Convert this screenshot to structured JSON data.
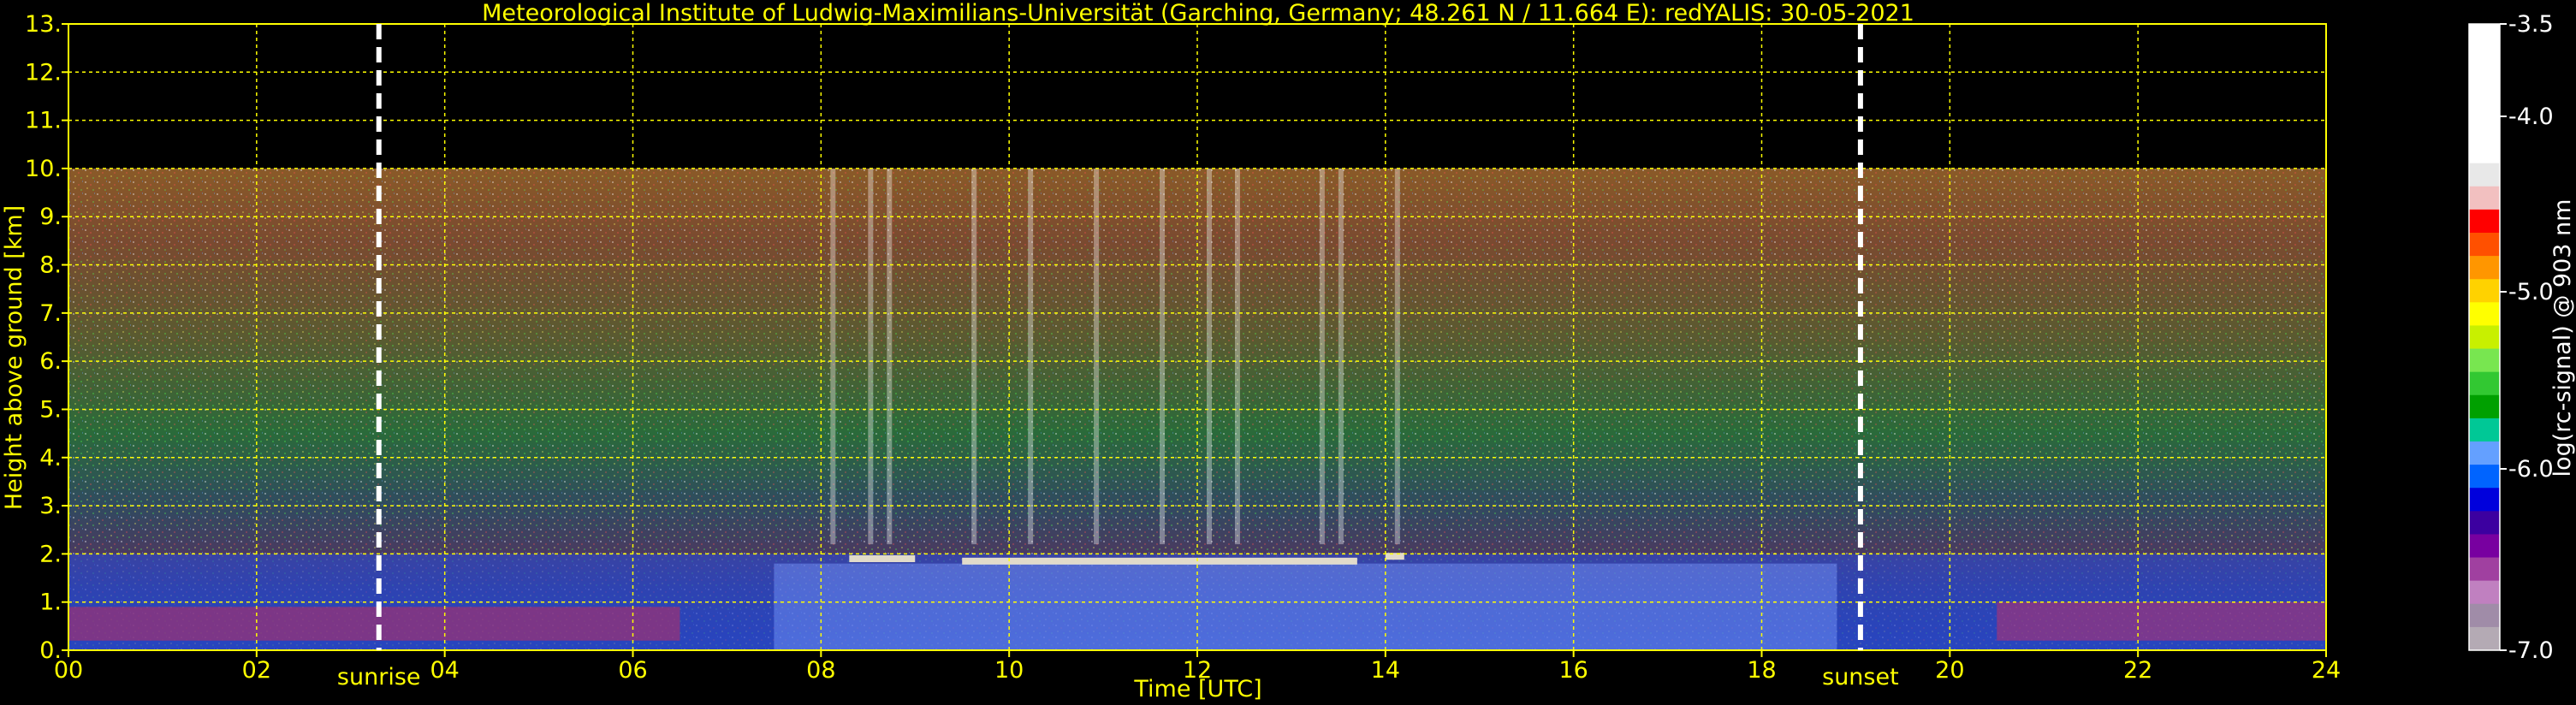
{
  "chart_data": {
    "type": "heatmap",
    "title": "Meteorological Institute of Ludwig-Maximilians-Universität (Garching, Germany; 48.261 N / 11.664 E):    redYALIS: 30-05-2021",
    "xlabel": "Time [UTC]",
    "ylabel": "Height above ground [km]",
    "xlim": [
      0,
      24
    ],
    "ylim": [
      0,
      13
    ],
    "x_ticks": [
      "00",
      "02",
      "04",
      "06",
      "08",
      "10",
      "12",
      "14",
      "16",
      "18",
      "20",
      "22",
      "24"
    ],
    "y_ticks": [
      "0.",
      "1.",
      "2.",
      "3.",
      "4.",
      "5.",
      "6.",
      "7.",
      "8.",
      "9.",
      "10.",
      "11.",
      "12.",
      "13."
    ],
    "grid": true,
    "data_top_height_km": 10,
    "events": [
      {
        "label": "sunrise",
        "time_h": 3.3
      },
      {
        "label": "sunset",
        "time_h": 19.05
      }
    ],
    "cloud_layers": [
      {
        "start_h": 8.3,
        "end_h": 9.0,
        "height_km": 1.9
      },
      {
        "start_h": 9.5,
        "end_h": 13.7,
        "height_km": 1.85
      },
      {
        "start_h": 14.0,
        "end_h": 14.2,
        "height_km": 1.95
      }
    ],
    "colorbar": {
      "label": "log(rc-signal) @ 903 nm",
      "min": -7.0,
      "max": -3.5,
      "tick_labels": [
        "-3.5",
        "-4.0",
        "-5.0",
        "-6.0",
        "-7.0"
      ],
      "tick_values": [
        -3.5,
        -4.0,
        -5.0,
        -6.0,
        -7.0
      ],
      "colors": [
        "#ffffff",
        "#e8e8e8",
        "#f2c0c0",
        "#ff0000",
        "#ff5000",
        "#ff9600",
        "#ffd200",
        "#ffff00",
        "#c8f000",
        "#78e650",
        "#32c832",
        "#00a000",
        "#00c896",
        "#64a0ff",
        "#0064ff",
        "#0000dc",
        "#3c00a0",
        "#7800a0",
        "#a040a0",
        "#c080c0",
        "#a08ca8",
        "#b4aab4"
      ]
    }
  },
  "colors": {
    "text": "#ffff00",
    "grid": "#ffff00",
    "marker": "#ffffff"
  }
}
